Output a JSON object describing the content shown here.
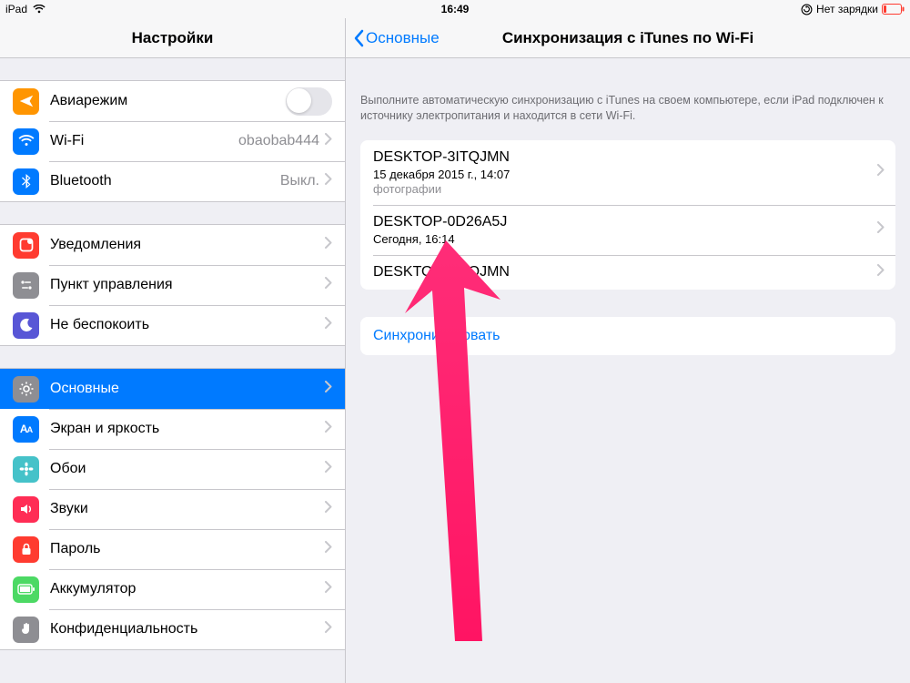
{
  "statusbar": {
    "device": "iPad",
    "time": "16:49",
    "battery_text": "Нет зарядки"
  },
  "sidebar": {
    "title": "Настройки",
    "group1": [
      {
        "key": "airplane",
        "label": "Авиарежим",
        "type": "toggle",
        "on": false
      },
      {
        "key": "wifi",
        "label": "Wi-Fi",
        "value": "obaobab444",
        "type": "link"
      },
      {
        "key": "bluetooth",
        "label": "Bluetooth",
        "value": "Выкл.",
        "type": "link"
      }
    ],
    "group2": [
      {
        "key": "notifications",
        "label": "Уведомления"
      },
      {
        "key": "control-center",
        "label": "Пункт управления"
      },
      {
        "key": "dnd",
        "label": "Не беспокоить"
      }
    ],
    "group3": [
      {
        "key": "general",
        "label": "Основные",
        "selected": true
      },
      {
        "key": "display",
        "label": "Экран и яркость"
      },
      {
        "key": "wallpaper",
        "label": "Обои"
      },
      {
        "key": "sounds",
        "label": "Звуки"
      },
      {
        "key": "passcode",
        "label": "Пароль"
      },
      {
        "key": "battery",
        "label": "Аккумулятор"
      },
      {
        "key": "privacy",
        "label": "Конфиденциальность"
      }
    ]
  },
  "detail": {
    "back_label": "Основные",
    "title": "Синхронизация с iTunes по Wi-Fi",
    "description": "Выполните автоматическую синхронизацию с iTunes на своем компьютере, если iPad подключен к источнику электропитания и находится в сети Wi-Fi.",
    "computers": [
      {
        "name": "DESKTOP-3ITQJMN",
        "sub": "15 декабря 2015 г., 14:07",
        "meta": "фотографии"
      },
      {
        "name": "DESKTOP-0D26A5J",
        "sub": "Сегодня, 16:14",
        "meta": ""
      },
      {
        "name": "DESKTOP-3ITQJMN",
        "sub": "",
        "meta": ""
      }
    ],
    "sync_button": "Синхронизировать"
  },
  "icons": {
    "airplane": {
      "bg": "#ff9500",
      "glyph": "airplane"
    },
    "wifi": {
      "bg": "#007aff",
      "glyph": "wifi"
    },
    "bluetooth": {
      "bg": "#007aff",
      "glyph": "bluetooth"
    },
    "notifications": {
      "bg": "#ff3b30",
      "glyph": "notify"
    },
    "control-center": {
      "bg": "#8e8e93",
      "glyph": "control"
    },
    "dnd": {
      "bg": "#5856d6",
      "glyph": "moon"
    },
    "general": {
      "bg": "#8e8e93",
      "glyph": "gear"
    },
    "display": {
      "bg": "#007aff",
      "glyph": "AA"
    },
    "wallpaper": {
      "bg": "#45c2c9",
      "glyph": "flower"
    },
    "sounds": {
      "bg": "#ff2d55",
      "glyph": "speaker"
    },
    "passcode": {
      "bg": "#ff3b30",
      "glyph": "lock"
    },
    "battery": {
      "bg": "#4cd964",
      "glyph": "battery"
    },
    "privacy": {
      "bg": "#8e8e93",
      "glyph": "hand"
    }
  }
}
